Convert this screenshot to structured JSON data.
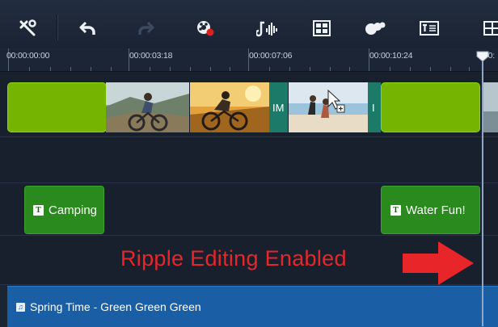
{
  "toolbar": {
    "icons": [
      "tools-icon",
      "undo-icon",
      "redo-icon",
      "record-icon",
      "audio-mixer-icon",
      "pan-zoom-icon",
      "mask-icon",
      "title-icon",
      "multi-screen-icon"
    ]
  },
  "ruler": {
    "timecodes": [
      "00:00:00:00",
      "00:00:03:18",
      "00:00:07:06",
      "00:00:10:24",
      "00:"
    ]
  },
  "video_track": {
    "transition_labels": [
      "IM",
      "I"
    ]
  },
  "title_track": {
    "clips": [
      {
        "label": "Camping"
      },
      {
        "label": "Water Fun!"
      }
    ]
  },
  "overlay_text": "Ripple Editing Enabled",
  "audio_track": {
    "clip_label": "Spring Time - Green Green Green"
  },
  "colors": {
    "background": "#1b2433",
    "color_clip": "#75b400",
    "title_clip": "#2a8a1e",
    "audio_clip": "#1a5fa6",
    "overlay_red": "#e8262a"
  }
}
